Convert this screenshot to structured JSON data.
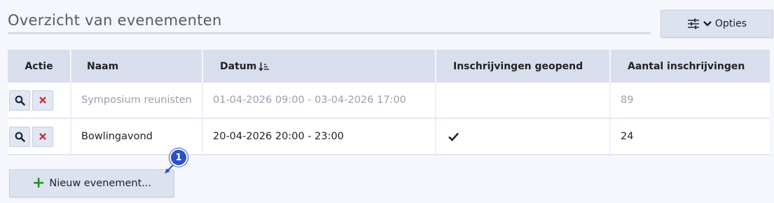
{
  "page": {
    "title": "Overzicht van evenementen"
  },
  "options_button": {
    "label": "Opties",
    "icons": [
      "sliders-icon",
      "chevron-down-icon"
    ]
  },
  "table": {
    "columns": [
      "Actie",
      "Naam",
      "Datum",
      "Inschrijvingen geopend",
      "Aantal inschrijvingen"
    ],
    "sorted_column": "Datum",
    "sort_direction": "ascending",
    "rows": [
      {
        "name": "Symposium reunisten",
        "date": "01-04-2026 09:00 - 03-04-2026 17:00",
        "registrations_open": false,
        "count": "89",
        "muted": true
      },
      {
        "name": "Bowlingavond",
        "date": "20-04-2026 20:00 - 23:00",
        "registrations_open": true,
        "count": "24",
        "muted": false
      }
    ]
  },
  "new_button": {
    "label": "Nieuw evenement..."
  },
  "annotation": {
    "step": "1"
  },
  "colors": {
    "header_bg": "#d9deef",
    "button_bg": "#dde2f0",
    "delete_red": "#c0392b",
    "plus_green": "#2f8a2f",
    "badge_blue": "#2b50c8"
  }
}
